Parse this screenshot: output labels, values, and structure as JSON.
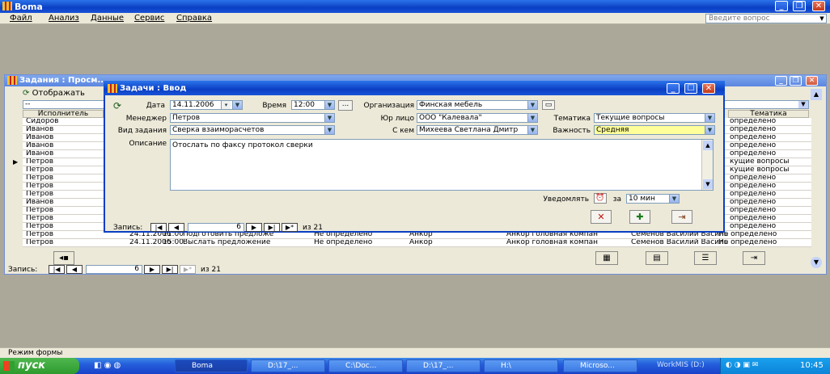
{
  "app": {
    "title": "Boma"
  },
  "menu": {
    "items": [
      "Файл",
      "Анализ",
      "Данные",
      "Сервис",
      "Справка"
    ],
    "ask_placeholder": "Введите вопрос"
  },
  "bg_form": {
    "title": "Задания : Просм...",
    "show_label": "Отображать",
    "filter_value": "--",
    "col_executor": "Исполнитель",
    "col_topic": "Тематика",
    "rows": [
      {
        "executor": "Сидоров",
        "topic": "определено"
      },
      {
        "executor": "Иванов",
        "topic": "определено"
      },
      {
        "executor": "Иванов",
        "topic": "определено"
      },
      {
        "executor": "Иванов",
        "topic": "определено"
      },
      {
        "executor": "Иванов",
        "topic": "определено"
      },
      {
        "executor": "Петров",
        "topic": "кущие вопросы",
        "selected": true
      },
      {
        "executor": "Петров",
        "topic": "кущие вопросы"
      },
      {
        "executor": "Петров",
        "topic": "определено"
      },
      {
        "executor": "Петров",
        "topic": "определено"
      },
      {
        "executor": "Петров",
        "topic": "определено"
      },
      {
        "executor": "Иванов",
        "topic": "определено"
      },
      {
        "executor": "Петров",
        "topic": "определено"
      },
      {
        "executor": "Петров",
        "topic": "определено"
      },
      {
        "executor": "Петров",
        "topic": "определено"
      }
    ],
    "full_rows": [
      {
        "executor": "Петров",
        "date": "24.11.2006",
        "time": "11:00",
        "task": "Подготовить предложе",
        "status": "Не определено",
        "org": "Анкор",
        "legal": "Анкор головная компан",
        "contact": "Семенов Василий Василь",
        "topic": "Не определено"
      },
      {
        "executor": "Петров",
        "date": "24.11.2006",
        "time": "15:00",
        "task": "Выслать предложение",
        "status": "Не определено",
        "org": "Анкор",
        "legal": "Анкор головная компан",
        "contact": "Семенов Василий Василь",
        "topic": "Не определено"
      }
    ],
    "record_label": "Запись:",
    "record_num": "6",
    "record_of": "из 21"
  },
  "dialog": {
    "title": "Задачи : Ввод",
    "date_label": "Дата",
    "date_value": "14.11.2006",
    "time_label": "Время",
    "time_value": "12:00",
    "org_label": "Организация",
    "org_value": "Финская мебель",
    "manager_label": "Менеджер",
    "manager_value": "Петров",
    "legal_label": "Юр лицо",
    "legal_value": "ООО \"Калевала\"",
    "topic_label": "Тематика",
    "topic_value": "Текущие вопросы",
    "tasktype_label": "Вид задания",
    "tasktype_value": "Сверка взаиморасчетов",
    "with_label": "С кем",
    "with_value": "Михеева Светлана Дмитр",
    "importance_label": "Важность",
    "importance_value": "Средняя",
    "desc_label": "Описание",
    "desc_value": "Отослать по факсу протокол сверки",
    "notify_label": "Уведомлять",
    "notify_for": "за",
    "notify_value": "10 мин",
    "record_label": "Запись:",
    "record_num": "6",
    "record_of": "из 21",
    "importance_color": "#ffff99"
  },
  "status": {
    "text": "Режим формы"
  },
  "taskbar": {
    "start": "пуск",
    "tasks": [
      "Boma",
      "D:\\17_...",
      "C:\\Doc...",
      "D:\\17_...",
      "H:\\",
      "Microso...",
      "WorkMIS (D:)"
    ],
    "clock": "10:45"
  }
}
